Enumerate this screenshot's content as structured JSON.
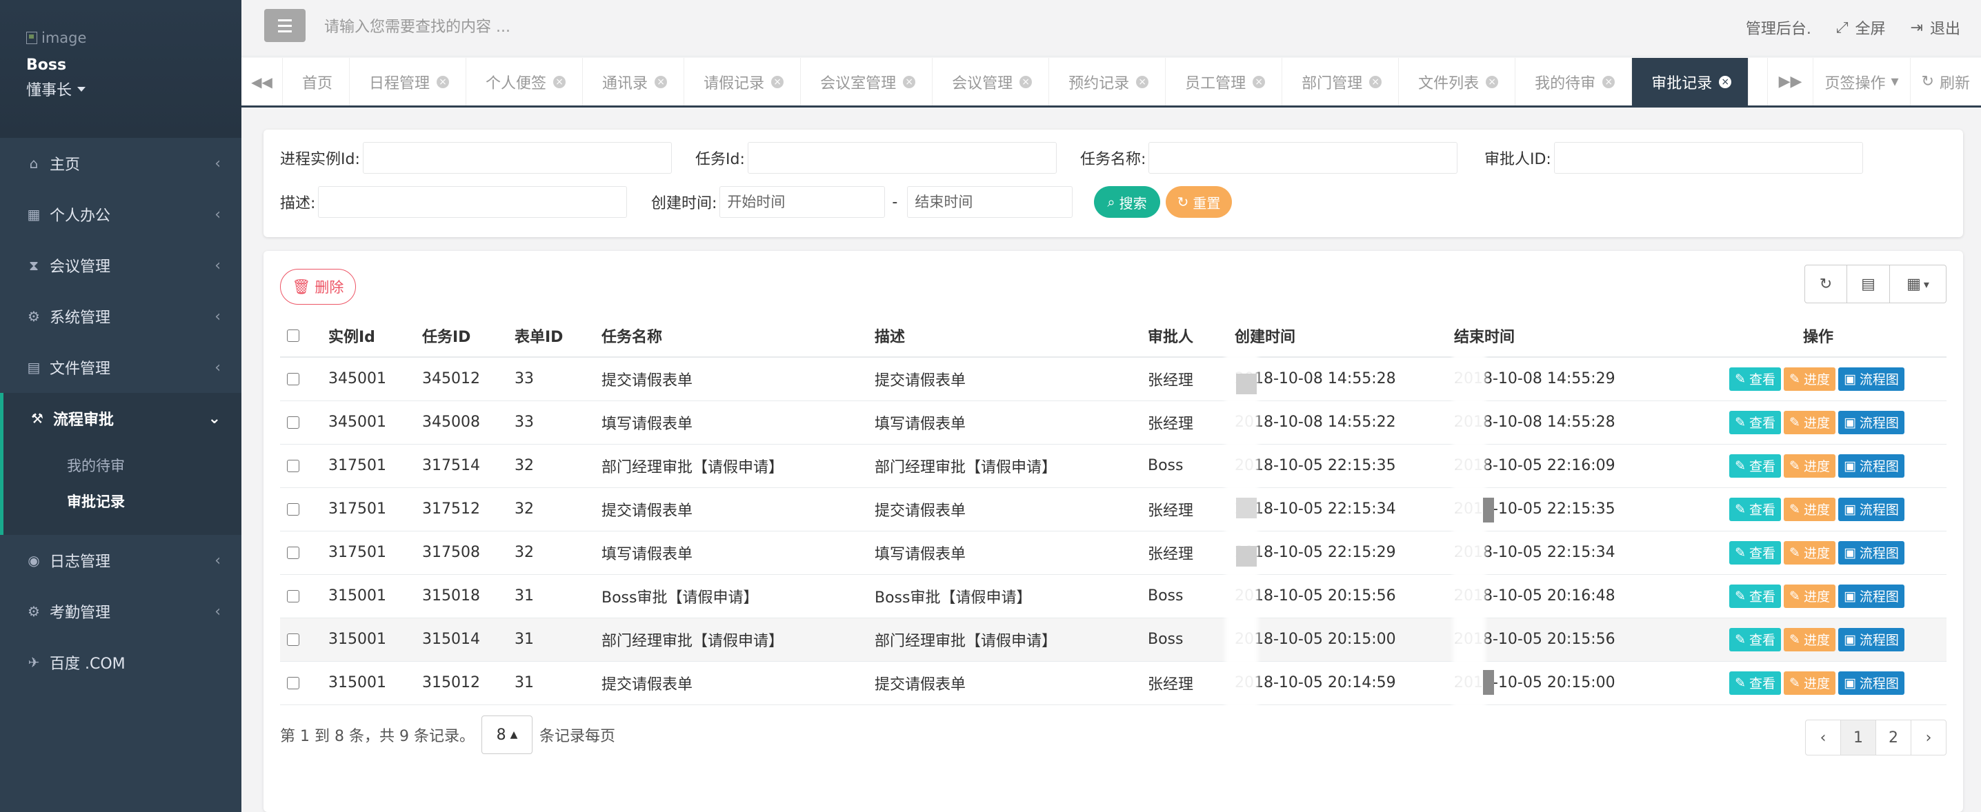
{
  "profile": {
    "avatar_alt": "image",
    "name": "Boss",
    "role": "懂事长"
  },
  "sidebar": {
    "items": [
      {
        "label": "主页",
        "icon": "home-icon",
        "glyph": "⌂"
      },
      {
        "label": "个人办公",
        "icon": "calendar-icon",
        "glyph": "▦"
      },
      {
        "label": "会议管理",
        "icon": "hourglass-icon",
        "glyph": "⧗"
      },
      {
        "label": "系统管理",
        "icon": "gear-icon",
        "glyph": "⚙"
      },
      {
        "label": "文件管理",
        "icon": "file-icon",
        "glyph": "▤"
      },
      {
        "label": "流程审批",
        "icon": "gavel-icon",
        "glyph": "⚒"
      },
      {
        "label": "日志管理",
        "icon": "eye-icon",
        "glyph": "◉"
      },
      {
        "label": "考勤管理",
        "icon": "gears-icon",
        "glyph": "⚙"
      },
      {
        "label": "百度 .COM",
        "icon": "plane-icon",
        "glyph": "✈"
      }
    ],
    "submenu": [
      "我的待审",
      "审批记录"
    ]
  },
  "topbar": {
    "search_placeholder": "请输入您需要查找的内容 ...",
    "admin_label": "管理后台.",
    "fullscreen_label": "全屏",
    "logout_label": "退出"
  },
  "tabs": [
    "首页",
    "日程管理",
    "个人便签",
    "通讯录",
    "请假记录",
    "会议室管理",
    "会议管理",
    "预约记录",
    "员工管理",
    "部门管理",
    "文件列表",
    "我的待审",
    "审批记录"
  ],
  "tabbar": {
    "page_ops": "页签操作",
    "refresh": "刷新"
  },
  "search": {
    "proc_label": "进程实例Id:",
    "task_label": "任务Id:",
    "taskname_label": "任务名称:",
    "approver_label": "审批人ID:",
    "desc_label": "描述:",
    "created_label": "创建时间:",
    "start_placeholder": "开始时间",
    "dash": "-",
    "end_placeholder": "结束时间",
    "search_btn": "搜索",
    "reset_btn": "重置"
  },
  "table": {
    "delete_btn": "删除",
    "headers": [
      "实例Id",
      "任务ID",
      "表单ID",
      "任务名称",
      "描述",
      "审批人",
      "创建时间",
      "结束时间",
      "操作"
    ],
    "rows": [
      [
        "345001",
        "345012",
        "33",
        "提交请假表单",
        "提交请假表单",
        "张经理",
        "2018-10-08 14:55:28",
        "2018-10-08 14:55:29"
      ],
      [
        "345001",
        "345008",
        "33",
        "填写请假表单",
        "填写请假表单",
        "张经理",
        "2018-10-08 14:55:22",
        "2018-10-08 14:55:28"
      ],
      [
        "317501",
        "317514",
        "32",
        "部门经理审批【请假申请】",
        "部门经理审批【请假申请】",
        "Boss",
        "2018-10-05 22:15:35",
        "2018-10-05 22:16:09"
      ],
      [
        "317501",
        "317512",
        "32",
        "提交请假表单",
        "提交请假表单",
        "张经理",
        "2018-10-05 22:15:34",
        "2018-10-05 22:15:35"
      ],
      [
        "317501",
        "317508",
        "32",
        "填写请假表单",
        "填写请假表单",
        "张经理",
        "2018-10-05 22:15:29",
        "2018-10-05 22:15:34"
      ],
      [
        "315001",
        "315018",
        "31",
        "Boss审批【请假申请】",
        "Boss审批【请假申请】",
        "Boss",
        "2018-10-05 20:15:56",
        "2018-10-05 20:16:48"
      ],
      [
        "315001",
        "315014",
        "31",
        "部门经理审批【请假申请】",
        "部门经理审批【请假申请】",
        "Boss",
        "2018-10-05 20:15:00",
        "2018-10-05 20:15:56"
      ],
      [
        "315001",
        "315012",
        "31",
        "提交请假表单",
        "提交请假表单",
        "张经理",
        "2018-10-05 20:14:59",
        "2018-10-05 20:15:00"
      ]
    ],
    "actions": {
      "view": "查看",
      "progress": "进度",
      "flow": "流程图"
    }
  },
  "pagination": {
    "info": "第 1 到 8 条，共 9 条记录。",
    "page_size": "8",
    "per_page": "条记录每页",
    "prev": "‹",
    "pages": [
      "1",
      "2"
    ],
    "next": "›"
  },
  "colors": {
    "sidebar_bg": "#2f4050",
    "accent": "#19aa8d",
    "active_tab": "#2f4050",
    "search_btn": "#1ab394",
    "reset_btn": "#f8ac59"
  }
}
